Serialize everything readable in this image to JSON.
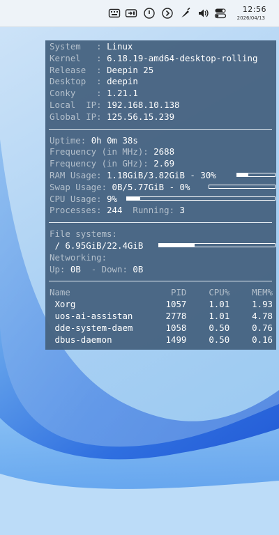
{
  "taskbar": {
    "icons": [
      "keyboard-icon",
      "input-method-icon",
      "power-icon",
      "arrow-circle-icon",
      "pen-icon",
      "volume-icon",
      "toggle-icon"
    ],
    "time": "12:56",
    "date": "2026/04/13"
  },
  "conky": {
    "system": {
      "label": "System   :",
      "value": "Linux"
    },
    "kernel": {
      "label": "Kernel   :",
      "value": "6.18.19-amd64-desktop-rolling"
    },
    "release": {
      "label": "Release  :",
      "value": "Deepin 25"
    },
    "desktop": {
      "label": "Desktop  :",
      "value": "deepin"
    },
    "conky_ver": {
      "label": "Conky    :",
      "value": "1.21.1"
    },
    "local_ip": {
      "label": "Local  IP:",
      "value": "192.168.10.138"
    },
    "global_ip": {
      "label": "Global IP:",
      "value": "125.56.15.239"
    },
    "uptime": {
      "label": "Uptime:",
      "value": "0h 0m 38s"
    },
    "freq_mhz": {
      "label": "Frequency (in MHz):",
      "value": "2688"
    },
    "freq_ghz": {
      "label": "Frequency (in GHz):",
      "value": "2.69"
    },
    "ram": {
      "label": "RAM Usage:",
      "value": "1.18GiB/3.82GiB - 30%",
      "percent": 30
    },
    "swap": {
      "label": "Swap Usage:",
      "value": "0B/5.77GiB - 0%",
      "percent": 0
    },
    "cpu": {
      "label": "CPU Usage:",
      "value": "9%",
      "percent": 9
    },
    "processes": {
      "label": "Processes:",
      "value": "244",
      "running_label": "Running:",
      "running_value": "3"
    },
    "filesystems": {
      "label": "File systems:",
      "mount": " /",
      "value": "6.95GiB/22.4GiB",
      "percent": 31
    },
    "networking": {
      "label": "Networking:",
      "up_label": "Up:",
      "up_value": "0B",
      "down_label": "- Down:",
      "down_value": "0B"
    },
    "procs": {
      "headers": [
        "Name",
        "PID",
        "CPU%",
        "MEM%"
      ],
      "rows": [
        [
          "Xorg",
          "1057",
          "1.01",
          "1.93"
        ],
        [
          "uos-ai-assistan",
          "2778",
          "1.01",
          "4.78"
        ],
        [
          "dde-system-daem",
          "1058",
          "0.50",
          "0.76"
        ],
        [
          "dbus-daemon",
          "1499",
          "0.50",
          "0.16"
        ]
      ]
    }
  }
}
